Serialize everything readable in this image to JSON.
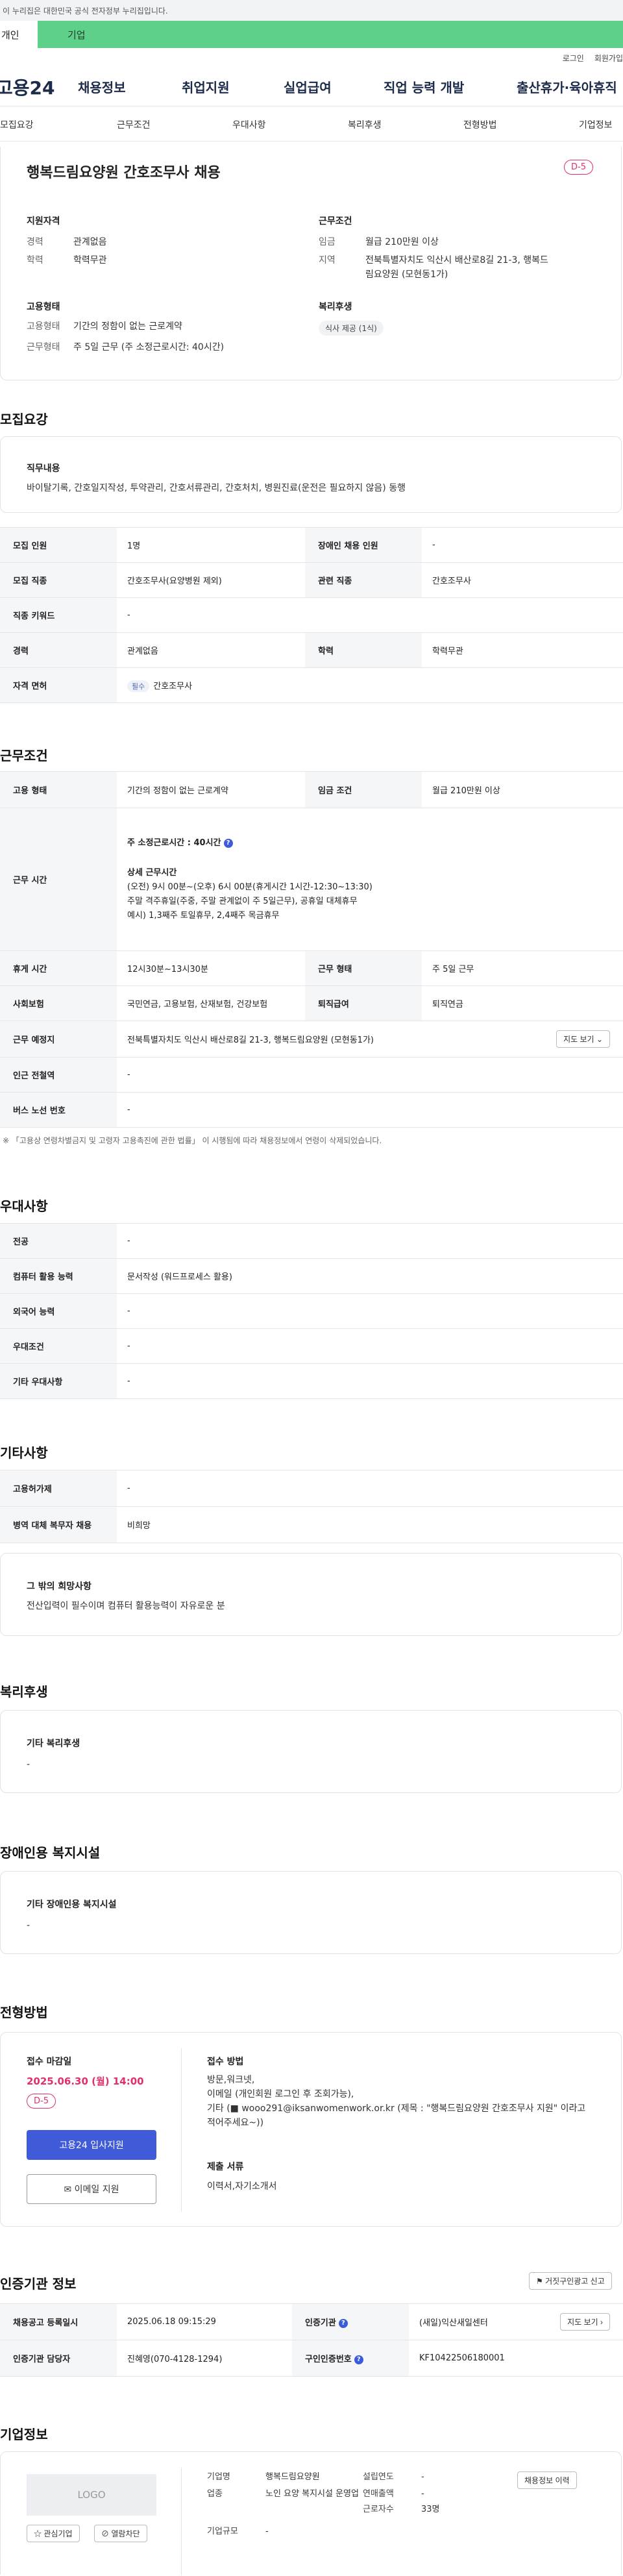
{
  "gov_banner": "이 누리집은 대한민국 공식 전자정부 누리집입니다.",
  "top_tabs": [
    "개인",
    "기업"
  ],
  "util": [
    "로그인",
    "회원가입"
  ],
  "logo": "고용24",
  "gnb": [
    "채용정보",
    "취업지원",
    "실업급여",
    "직업 능력 개발",
    "출산휴가·육아휴직"
  ],
  "subnav": [
    "모집요강",
    "근무조건",
    "우대사항",
    "복리후생",
    "전형방법",
    "기업정보"
  ],
  "summary": {
    "title": "행복드림요양원 간호조무사 채용",
    "dday": "D-5",
    "qual_title": "지원자격",
    "qual": [
      {
        "k": "경력",
        "v": "관계없음"
      },
      {
        "k": "학력",
        "v": "학력무관"
      }
    ],
    "cond_title": "근무조건",
    "cond": [
      {
        "k": "임금",
        "v": "월급 210만원 이상"
      },
      {
        "k": "지역",
        "v": "전북특별자치도 익산시 배산로8길 21-3, 행복드림요양원 (모현동1가)"
      }
    ],
    "emp_title": "고용형태",
    "emp": [
      {
        "k": "고용형태",
        "v": "기간의 정함이 없는 근로계약"
      },
      {
        "k": "근무형태",
        "v": "주 5일 근무 (주 소정근로시간: 40시간)"
      }
    ],
    "welfare_title": "복리후생",
    "welfare_tag": "식사 제공 (1식)"
  },
  "recruit": {
    "title": "모집요강",
    "duty_label": "직무내용",
    "duty_text": "바이탈기록, 간호일지작성, 투약관리, 간호서류관리, 간호처치, 병원진료(운전은 필요하지 않음) 동행",
    "rows": [
      [
        "모집 인원",
        "1명",
        "장애인 채용 인원",
        "-"
      ],
      [
        "모집 직종",
        "간호조무사(요양병원 제외)",
        "관련 직종",
        "간호조무사"
      ],
      [
        "직종 키워드",
        "-",
        "",
        ""
      ],
      [
        "경력",
        "관계없음",
        "학력",
        "학력무관"
      ]
    ],
    "license_label": "자격 면허",
    "license_tag": "필수",
    "license_value": "간호조무사"
  },
  "work": {
    "title": "근무조건",
    "emp_label": "고용 형태",
    "emp_value": "기간의 정함이 없는 근로계약",
    "wage_label": "임금 조건",
    "wage_value": "월급 210만원 이상",
    "hours_label": "근무 시간",
    "hours_main": "주 소정근로시간 : 40시간",
    "hours_detail_title": "상세 근무시간",
    "hours_lines": [
      "(오전) 9시 00분~(오후) 6시 00분(휴게시간 1시간-12:30~13:30)",
      "주말 격주휴일(주중, 주말 관계없이 주 5일근무), 공휴일 대체휴무",
      "예시) 1,3째주 토일휴무, 2,4째주 목금휴무"
    ],
    "break_label": "휴게 시간",
    "break_value": "12시30분~13시30분",
    "type_label": "근무 형태",
    "type_value": "주 5일 근무",
    "ins_label": "사회보험",
    "ins_value": "국민연금, 고용보험, 산재보험, 건강보험",
    "sev_label": "퇴직급여",
    "sev_value": "퇴직연금",
    "place_label": "근무 예정지",
    "place_value": "전북특별자치도 익산시 배산로8길 21-3, 행복드림요양원 (모현동1가)",
    "map_btn": "지도 보기",
    "subway_label": "인근 전철역",
    "subway_value": "-",
    "bus_label": "버스 노선 번호",
    "bus_value": "-",
    "note": "※ 「고용상 연령차별금지 및 고령자 고용촉진에 관한 법률」 이 시행됨에 따라 채용정보에서 연령이 삭제되었습니다."
  },
  "pref": {
    "title": "우대사항",
    "rows": [
      [
        "전공",
        "-"
      ],
      [
        "컴퓨터 활용 능력",
        "문서작성 (워드프로세스 활용)"
      ],
      [
        "외국어 능력",
        "-"
      ],
      [
        "우대조건",
        "-"
      ],
      [
        "기타 우대사항",
        "-"
      ]
    ]
  },
  "etc": {
    "title": "기타사항",
    "rows": [
      [
        "고용허가제",
        "-"
      ],
      [
        "병역 대체 복무자 채용",
        "비희망"
      ]
    ],
    "hope_label": "그 밖의 희망사항",
    "hope_text": "전산입력이 필수이며 컴퓨터 활용능력이 자유로운 분"
  },
  "welfare": {
    "title": "복리후생",
    "label": "기타 복리후생",
    "value": "-"
  },
  "disabled": {
    "title": "장애인용 복지시설",
    "label": "기타 장애인용 복지시설",
    "value": "-"
  },
  "selection": {
    "title": "전형방법",
    "deadline_label": "접수 마감일",
    "deadline": "2025.06.30 (월) 14:00",
    "dday": "D-5",
    "apply_btn": "고용24 입사지원",
    "email_btn": "이메일 지원",
    "method_label": "접수 방법",
    "method_lines": [
      "방문,워크넷,",
      "이메일 (개인회원 로그인 후 조회가능),",
      "기타 (■ wooo291@iksanwomenwork.or.kr (제목 : \"행복드림요양원 간호조무사 지원\" 이라고 적어주세요~))"
    ],
    "docs_label": "제출 서류",
    "docs_value": "이력서,자기소개서"
  },
  "agency": {
    "title": "인증기관 정보",
    "report_btn": "거짓구인광고 신고",
    "rows": [
      [
        "채용공고 등록일시",
        "2025.06.18 09:15:29",
        "인증기관",
        "(새일)익산새일센터"
      ],
      [
        "인증기관 담당자",
        "진혜영(070-4128-1294)",
        "구인인증번호",
        "KF10422506180001"
      ]
    ],
    "map_btn": "지도 보기"
  },
  "company": {
    "title": "기업정보",
    "logo_text": "LOGO",
    "fav_btn": "관심기업",
    "block_btn": "열람차단",
    "history_btn": "채용정보 이력",
    "rows": [
      [
        "기업명",
        "행복드림요양원",
        "설립연도",
        "-"
      ],
      [
        "업종",
        "노인 요양 복지시설 운영업",
        "연매출액",
        "-"
      ],
      [
        "",
        "",
        "근로자수",
        "33명"
      ],
      [
        "기업규모",
        "-",
        "",
        ""
      ]
    ]
  }
}
